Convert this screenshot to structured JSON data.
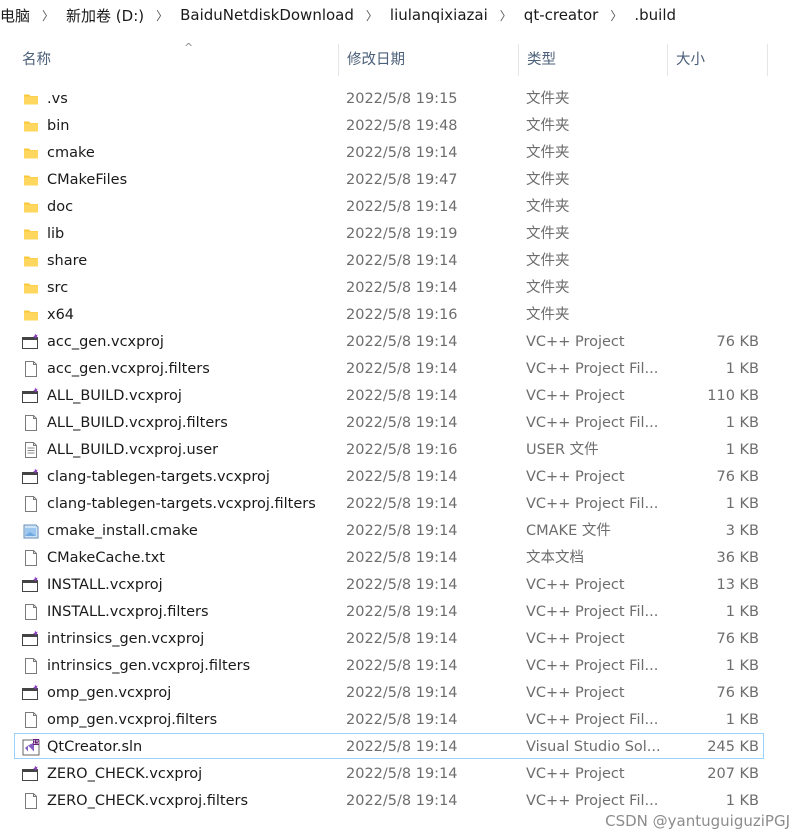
{
  "breadcrumb": [
    "电脑",
    "新加卷 (D:)",
    "BaiduNetdiskDownload",
    "liulanqixiazai",
    "qt-creator",
    ".build"
  ],
  "columns": {
    "name": "名称",
    "date": "修改日期",
    "type": "类型",
    "size": "大小"
  },
  "sort_indicator": "^",
  "files": [
    {
      "name": ".vs",
      "date": "2022/5/8 19:15",
      "type": "文件夹",
      "size": "",
      "icon": "folder-icon"
    },
    {
      "name": "bin",
      "date": "2022/5/8 19:48",
      "type": "文件夹",
      "size": "",
      "icon": "folder-icon"
    },
    {
      "name": "cmake",
      "date": "2022/5/8 19:14",
      "type": "文件夹",
      "size": "",
      "icon": "folder-icon"
    },
    {
      "name": "CMakeFiles",
      "date": "2022/5/8 19:47",
      "type": "文件夹",
      "size": "",
      "icon": "folder-icon"
    },
    {
      "name": "doc",
      "date": "2022/5/8 19:14",
      "type": "文件夹",
      "size": "",
      "icon": "folder-icon"
    },
    {
      "name": "lib",
      "date": "2022/5/8 19:19",
      "type": "文件夹",
      "size": "",
      "icon": "folder-icon"
    },
    {
      "name": "share",
      "date": "2022/5/8 19:14",
      "type": "文件夹",
      "size": "",
      "icon": "folder-icon"
    },
    {
      "name": "src",
      "date": "2022/5/8 19:14",
      "type": "文件夹",
      "size": "",
      "icon": "folder-icon"
    },
    {
      "name": "x64",
      "date": "2022/5/8 19:16",
      "type": "文件夹",
      "size": "",
      "icon": "folder-icon"
    },
    {
      "name": "acc_gen.vcxproj",
      "date": "2022/5/8 19:14",
      "type": "VC++ Project",
      "size": "76 KB",
      "icon": "vcxproj-icon"
    },
    {
      "name": "acc_gen.vcxproj.filters",
      "date": "2022/5/8 19:14",
      "type": "VC++ Project Fil...",
      "size": "1 KB",
      "icon": "file-icon"
    },
    {
      "name": "ALL_BUILD.vcxproj",
      "date": "2022/5/8 19:14",
      "type": "VC++ Project",
      "size": "110 KB",
      "icon": "vcxproj-icon"
    },
    {
      "name": "ALL_BUILD.vcxproj.filters",
      "date": "2022/5/8 19:14",
      "type": "VC++ Project Fil...",
      "size": "1 KB",
      "icon": "file-icon"
    },
    {
      "name": "ALL_BUILD.vcxproj.user",
      "date": "2022/5/8 19:16",
      "type": "USER 文件",
      "size": "1 KB",
      "icon": "text-file-icon"
    },
    {
      "name": "clang-tablegen-targets.vcxproj",
      "date": "2022/5/8 19:14",
      "type": "VC++ Project",
      "size": "76 KB",
      "icon": "vcxproj-icon"
    },
    {
      "name": "clang-tablegen-targets.vcxproj.filters",
      "date": "2022/5/8 19:14",
      "type": "VC++ Project Fil...",
      "size": "1 KB",
      "icon": "file-icon"
    },
    {
      "name": "cmake_install.cmake",
      "date": "2022/5/8 19:14",
      "type": "CMAKE 文件",
      "size": "3 KB",
      "icon": "cmake-icon"
    },
    {
      "name": "CMakeCache.txt",
      "date": "2022/5/8 19:14",
      "type": "文本文档",
      "size": "36 KB",
      "icon": "file-icon"
    },
    {
      "name": "INSTALL.vcxproj",
      "date": "2022/5/8 19:14",
      "type": "VC++ Project",
      "size": "13 KB",
      "icon": "vcxproj-icon"
    },
    {
      "name": "INSTALL.vcxproj.filters",
      "date": "2022/5/8 19:14",
      "type": "VC++ Project Fil...",
      "size": "1 KB",
      "icon": "file-icon"
    },
    {
      "name": "intrinsics_gen.vcxproj",
      "date": "2022/5/8 19:14",
      "type": "VC++ Project",
      "size": "76 KB",
      "icon": "vcxproj-icon"
    },
    {
      "name": "intrinsics_gen.vcxproj.filters",
      "date": "2022/5/8 19:14",
      "type": "VC++ Project Fil...",
      "size": "1 KB",
      "icon": "file-icon"
    },
    {
      "name": "omp_gen.vcxproj",
      "date": "2022/5/8 19:14",
      "type": "VC++ Project",
      "size": "76 KB",
      "icon": "vcxproj-icon"
    },
    {
      "name": "omp_gen.vcxproj.filters",
      "date": "2022/5/8 19:14",
      "type": "VC++ Project Fil...",
      "size": "1 KB",
      "icon": "file-icon"
    },
    {
      "name": "QtCreator.sln",
      "date": "2022/5/8 19:14",
      "type": "Visual Studio Sol...",
      "size": "245 KB",
      "icon": "visual-studio-solution-icon",
      "selected": true
    },
    {
      "name": "ZERO_CHECK.vcxproj",
      "date": "2022/5/8 19:14",
      "type": "VC++ Project",
      "size": "207 KB",
      "icon": "vcxproj-icon"
    },
    {
      "name": "ZERO_CHECK.vcxproj.filters",
      "date": "2022/5/8 19:14",
      "type": "VC++ Project Fil...",
      "size": "1 KB",
      "icon": "file-icon"
    }
  ],
  "watermark": "CSDN @yantuguiguziPGJ"
}
